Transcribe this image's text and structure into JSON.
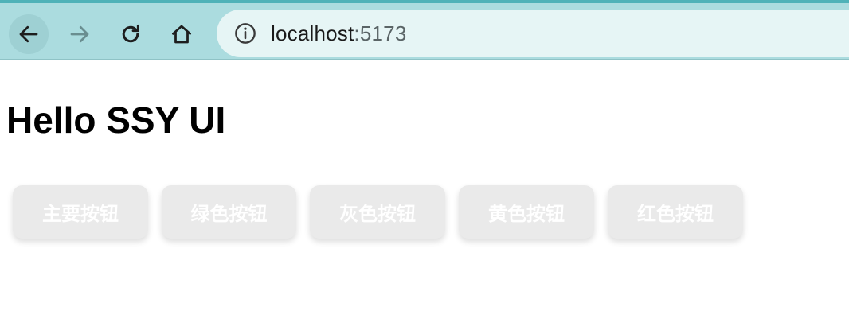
{
  "browser": {
    "url_host": "localhost",
    "url_port": ":5173",
    "icons": [
      "back-arrow-icon",
      "forward-arrow-icon",
      "reload-icon",
      "home-icon",
      "info-icon"
    ],
    "bar_color": "#abdcdf",
    "address_bg": "#e6f5f5"
  },
  "page": {
    "title": "Hello SSY UI",
    "buttons": [
      {
        "label": "主要按钮"
      },
      {
        "label": "绿色按钮"
      },
      {
        "label": "灰色按钮"
      },
      {
        "label": "黄色按钮"
      },
      {
        "label": "红色按钮"
      }
    ],
    "button_bg": "#eaeaea",
    "button_text_color": "#ffffff"
  }
}
